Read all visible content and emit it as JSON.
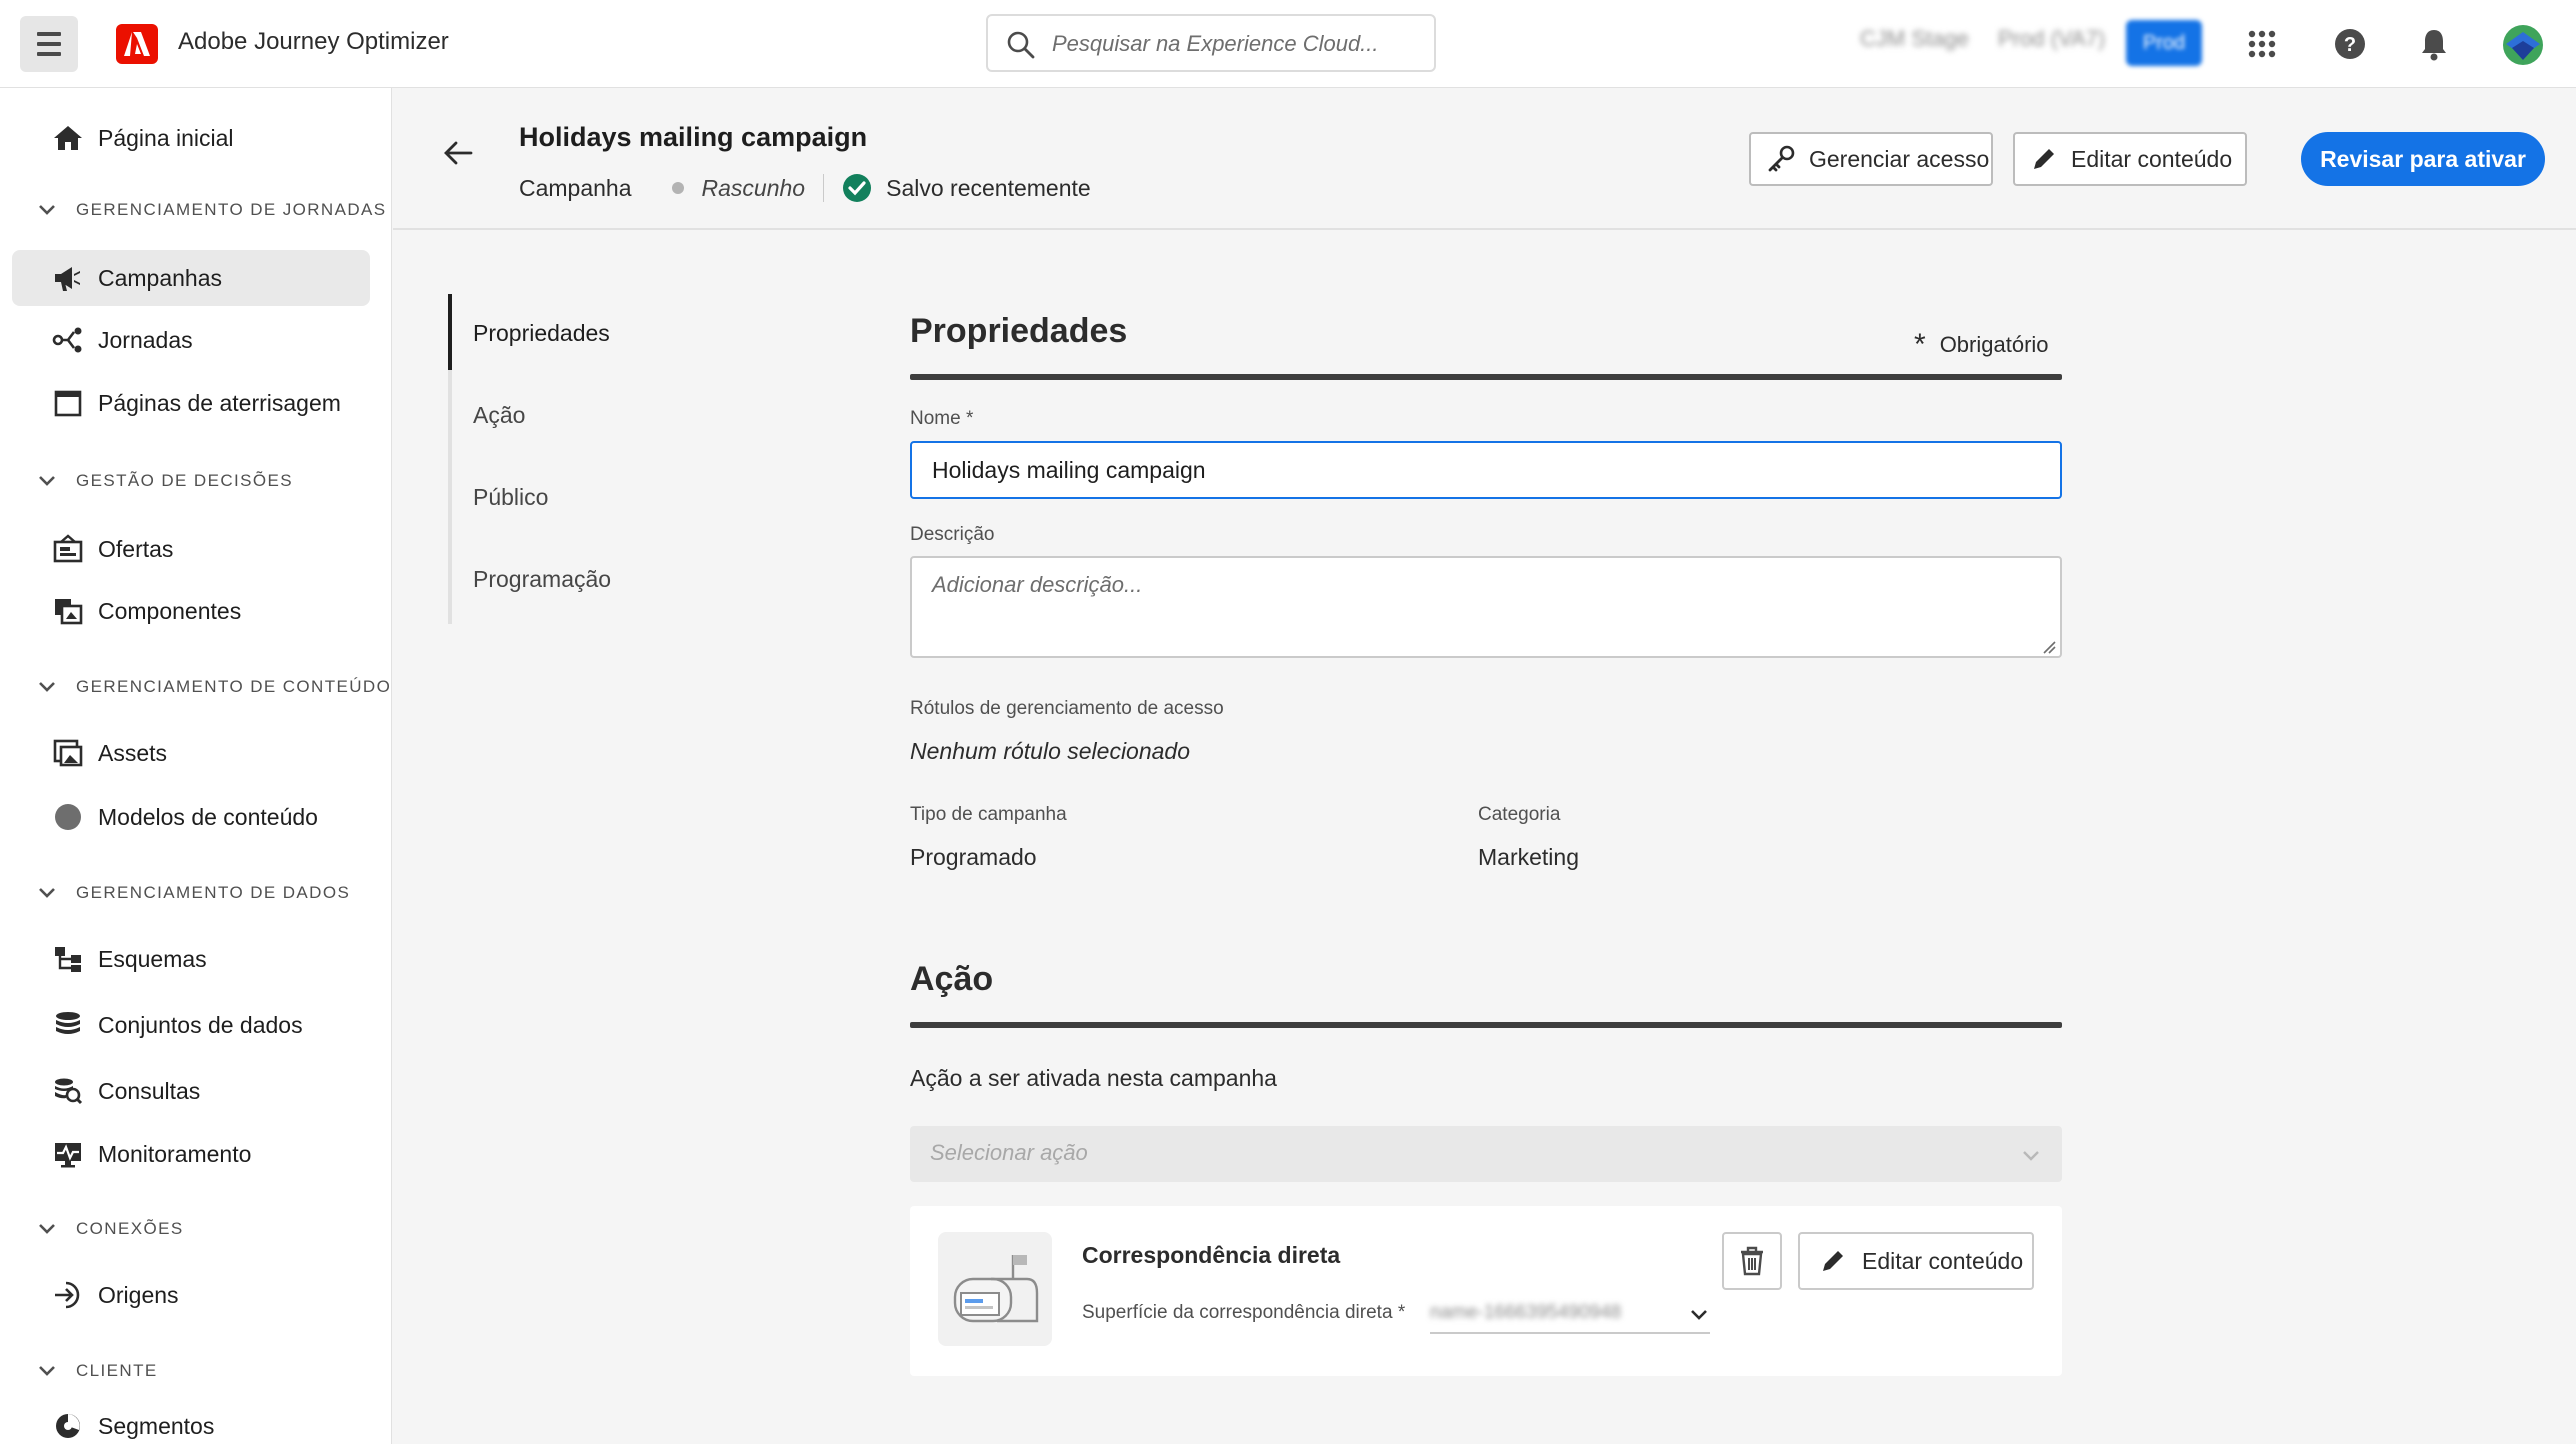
{
  "topbar": {
    "app_name": "Adobe Journey Optimizer",
    "search_placeholder": "Pesquisar na Experience Cloud...",
    "org_left": "CJM Stage",
    "org_middle": "Prod (VA7)",
    "org_active": "Prod",
    "icons": [
      "apps-grid-icon",
      "help-icon",
      "bell-icon",
      "avatar"
    ]
  },
  "sidebar": {
    "home": "Página inicial",
    "sections": [
      {
        "label": "GERENCIAMENTO DE JORNADAS",
        "items": [
          "Campanhas",
          "Jornadas",
          "Páginas de aterrisagem"
        ]
      },
      {
        "label": "GESTÃO DE DECISÕES",
        "items": [
          "Ofertas",
          "Componentes"
        ]
      },
      {
        "label": "GERENCIAMENTO DE CONTEÚDO",
        "items": [
          "Assets",
          "Modelos de conteúdo"
        ]
      },
      {
        "label": "GERENCIAMENTO DE DADOS",
        "items": [
          "Esquemas",
          "Conjuntos de dados",
          "Consultas",
          "Monitoramento"
        ]
      },
      {
        "label": "CONEXÕES",
        "items": [
          "Origens"
        ]
      },
      {
        "label": "CLIENTE",
        "items": [
          "Segmentos"
        ]
      }
    ],
    "active_item": "Campanhas"
  },
  "header": {
    "title": "Holidays mailing campaign",
    "type": "Campanha",
    "status": "Rascunho",
    "saved": "Salvo recentemente",
    "manage_access": "Gerenciar acesso",
    "edit_content": "Editar conteúdo",
    "review": "Revisar para ativar"
  },
  "inner_nav": [
    "Propriedades",
    "Ação",
    "Público",
    "Programação"
  ],
  "properties": {
    "title": "Propriedades",
    "required": "Obrigatório",
    "name_label": "Nome",
    "name_value": "Holidays mailing campaign",
    "description_label": "Descrição",
    "description_placeholder": "Adicionar descrição...",
    "access_labels_label": "Rótulos de gerenciamento de acesso",
    "access_labels_value": "Nenhum rótulo selecionado",
    "campaign_type_label": "Tipo de campanha",
    "campaign_type_value": "Programado",
    "category_label": "Categoria",
    "category_value": "Marketing"
  },
  "action": {
    "title": "Ação",
    "subtitle": "Ação a ser ativada nesta campanha",
    "select_placeholder": "Selecionar ação",
    "card_title": "Correspondência direta",
    "surface_label": "Superfície da correspondência direta",
    "surface_value": "name-1666395490948",
    "edit_content": "Editar conteúdo"
  },
  "colors": {
    "accent": "#1473e6",
    "brand": "#eb1000",
    "success": "#12805c"
  }
}
